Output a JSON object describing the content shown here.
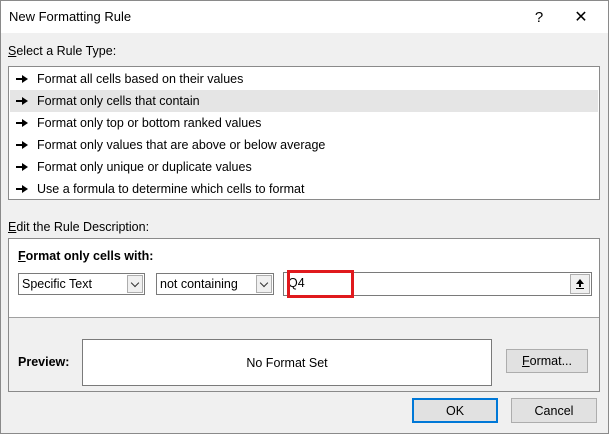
{
  "window": {
    "title": "New Formatting Rule",
    "help_label": "?",
    "close_label": "✕"
  },
  "rule_type": {
    "label_mnemonic": "S",
    "label_rest": "elect a Rule Type:",
    "items": [
      {
        "label": "Format all cells based on their values",
        "selected": false
      },
      {
        "label": "Format only cells that contain",
        "selected": true
      },
      {
        "label": "Format only top or bottom ranked values",
        "selected": false
      },
      {
        "label": "Format only values that are above or below average",
        "selected": false
      },
      {
        "label": "Format only unique or duplicate values",
        "selected": false
      },
      {
        "label": "Use a formula to determine which cells to format",
        "selected": false
      }
    ]
  },
  "description": {
    "label_mnemonic": "E",
    "label_rest": "dit the Rule Description:",
    "format_only_mnemonic": "F",
    "format_only_rest": "ormat only cells with:",
    "type_select": {
      "value": "Specific Text"
    },
    "operator_select": {
      "value": "not containing"
    },
    "text_value": "Q4",
    "highlight_color": "#e0191d"
  },
  "preview": {
    "label": "Preview:",
    "text": "No Format Set",
    "format_button_mnemonic": "F",
    "format_button_rest": "ormat..."
  },
  "footer": {
    "ok_label": "OK",
    "cancel_label": "Cancel",
    "ok_border_color": "#0078d7"
  }
}
